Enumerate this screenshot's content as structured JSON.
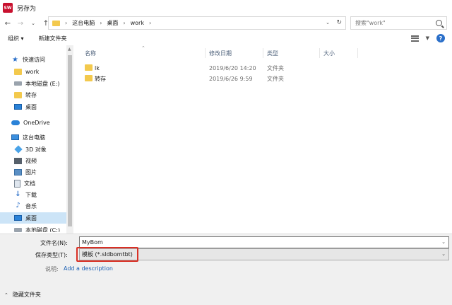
{
  "window": {
    "title": "另存为",
    "app_icon_text": "SW"
  },
  "address": {
    "crumbs": [
      "这台电脑",
      "桌面",
      "work"
    ],
    "search_placeholder": "搜索\"work\""
  },
  "toolbar": {
    "organize": "组织 ▾",
    "new_folder": "新建文件夹"
  },
  "sidebar": {
    "items": [
      {
        "label": "快速访问",
        "icon": "star-icon"
      },
      {
        "label": "work",
        "icon": "folder-icon"
      },
      {
        "label": "本地磁盘 (E:)",
        "icon": "drive-icon"
      },
      {
        "label": "转存",
        "icon": "folder-icon"
      },
      {
        "label": "桌面",
        "icon": "desktop-icon"
      },
      {
        "label": "OneDrive",
        "icon": "cloud-icon"
      },
      {
        "label": "这台电脑",
        "icon": "pc-icon"
      },
      {
        "label": "3D 对象",
        "icon": "cube-icon"
      },
      {
        "label": "视频",
        "icon": "video-icon"
      },
      {
        "label": "图片",
        "icon": "picture-icon"
      },
      {
        "label": "文档",
        "icon": "document-icon"
      },
      {
        "label": "下载",
        "icon": "download-icon"
      },
      {
        "label": "音乐",
        "icon": "music-icon"
      },
      {
        "label": "桌面",
        "icon": "desktop-icon"
      },
      {
        "label": "本地磁盘 (C:)",
        "icon": "drive-icon"
      }
    ]
  },
  "filelist": {
    "columns": [
      "名称",
      "修改日期",
      "类型",
      "大小"
    ],
    "rows": [
      {
        "name": "lk",
        "modified": "2019/6/20 14:20",
        "type": "文件夹",
        "size": ""
      },
      {
        "name": "转存",
        "modified": "2019/6/26 9:59",
        "type": "文件夹",
        "size": ""
      }
    ]
  },
  "form": {
    "filename_label": "文件名(N):",
    "filename_value": "MyBom",
    "filetype_label": "保存类型(T):",
    "filetype_value": "模板 (*.sldbomtbt)",
    "description_label": "说明:",
    "description_link": "Add a description",
    "hide_folders": "隐藏文件夹"
  },
  "colors": {
    "accent": "#2a6fc9",
    "highlight": "#d93025",
    "selected": "#cce4f7"
  }
}
